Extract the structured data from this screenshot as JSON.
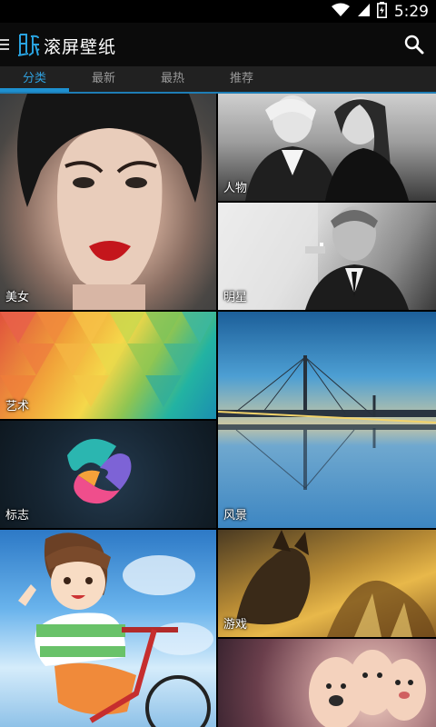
{
  "status_bar": {
    "time": "5:29",
    "icons": [
      "wifi-icon",
      "signal-icon",
      "battery-icon"
    ]
  },
  "app_bar": {
    "logo_icon": "paper-logo-icon",
    "title": "滚屏壁纸",
    "menu_icon": "menu-icon",
    "search_icon": "search-icon"
  },
  "tabs": [
    {
      "label": "分类",
      "active": true
    },
    {
      "label": "最新",
      "active": false
    },
    {
      "label": "最热",
      "active": false
    },
    {
      "label": "推荐",
      "active": false
    }
  ],
  "categories": [
    {
      "label": "美女"
    },
    {
      "label": "人物"
    },
    {
      "label": "明星"
    },
    {
      "label": "艺术"
    },
    {
      "label": "风景"
    },
    {
      "label": "标志"
    },
    {
      "label": "游戏"
    },
    {
      "label": ""
    },
    {
      "label": ""
    }
  ],
  "colors": {
    "accent": "#1e90d0",
    "tab_active_text": "#2f9fdc",
    "tab_inactive_text": "#9a9a9a",
    "app_bar_bg": "#0b0b0b",
    "tab_bar_bg": "#212121"
  }
}
